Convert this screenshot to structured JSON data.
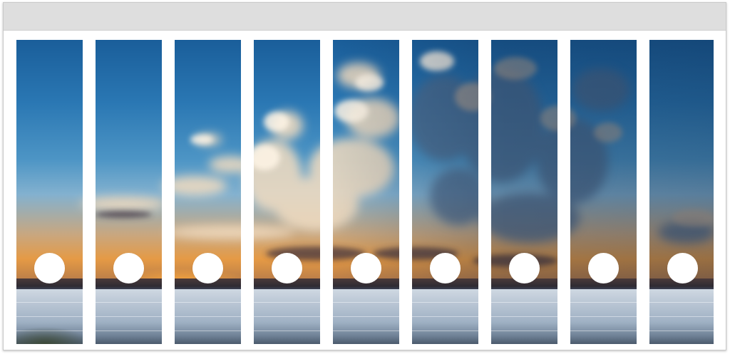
{
  "scene": {
    "description_icon": "sunset-sea-panorama",
    "colors": {
      "sky_top": "#1a5e9a",
      "sky_mid": "#4d95c5",
      "sunset_glow": "#e59a45",
      "sea": "#b6c3d2",
      "frame": "#ffffff",
      "top_bar": "#dedede"
    }
  },
  "spines": {
    "count": 9,
    "items": [
      {
        "id": 1,
        "ring_hole": true
      },
      {
        "id": 2,
        "ring_hole": true
      },
      {
        "id": 3,
        "ring_hole": true
      },
      {
        "id": 4,
        "ring_hole": true
      },
      {
        "id": 5,
        "ring_hole": true
      },
      {
        "id": 6,
        "ring_hole": true
      },
      {
        "id": 7,
        "ring_hole": true
      },
      {
        "id": 8,
        "ring_hole": true
      },
      {
        "id": 9,
        "ring_hole": true
      }
    ]
  }
}
